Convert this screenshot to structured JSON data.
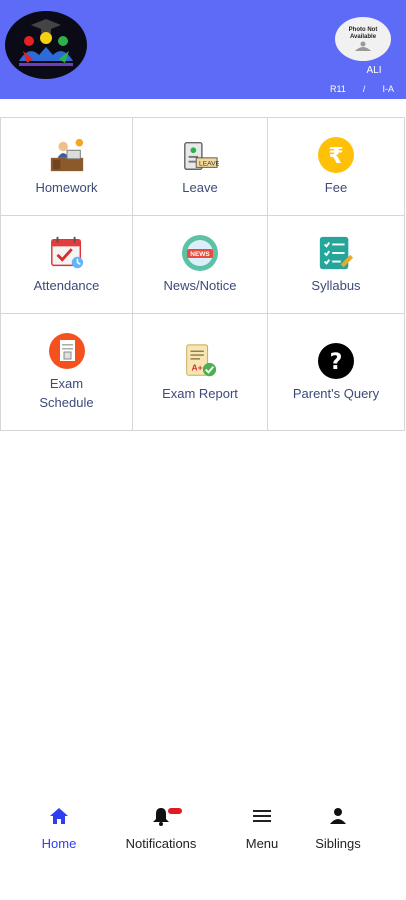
{
  "header": {
    "photo_text": "Photo Not Available",
    "student_name": "ALI",
    "roll": "R11",
    "separator": "/",
    "class_section": "I-A",
    "colors": {
      "background": "#5d6bf6"
    }
  },
  "tiles": [
    {
      "label": "Homework",
      "icon": "homework-icon"
    },
    {
      "label": "Leave",
      "icon": "leave-icon"
    },
    {
      "label": "Fee",
      "icon": "rupee-icon"
    },
    {
      "label": "Attendance",
      "icon": "calendar-icon"
    },
    {
      "label": "News/Notice",
      "icon": "news-icon"
    },
    {
      "label": "Syllabus",
      "icon": "checklist-icon"
    },
    {
      "label": "Exam Schedule",
      "icon": "exam-schedule-icon"
    },
    {
      "label": "Exam Report",
      "icon": "report-card-icon"
    },
    {
      "label": "Parent's Query",
      "icon": "question-icon"
    }
  ],
  "bottom_nav": [
    {
      "label": "Home",
      "icon": "home-icon",
      "active": true
    },
    {
      "label": "Notifications",
      "icon": "bell-icon",
      "active": false
    },
    {
      "label": "Menu",
      "icon": "hamburger-icon",
      "active": false
    },
    {
      "label": "Siblings",
      "icon": "person-icon",
      "active": false
    }
  ]
}
